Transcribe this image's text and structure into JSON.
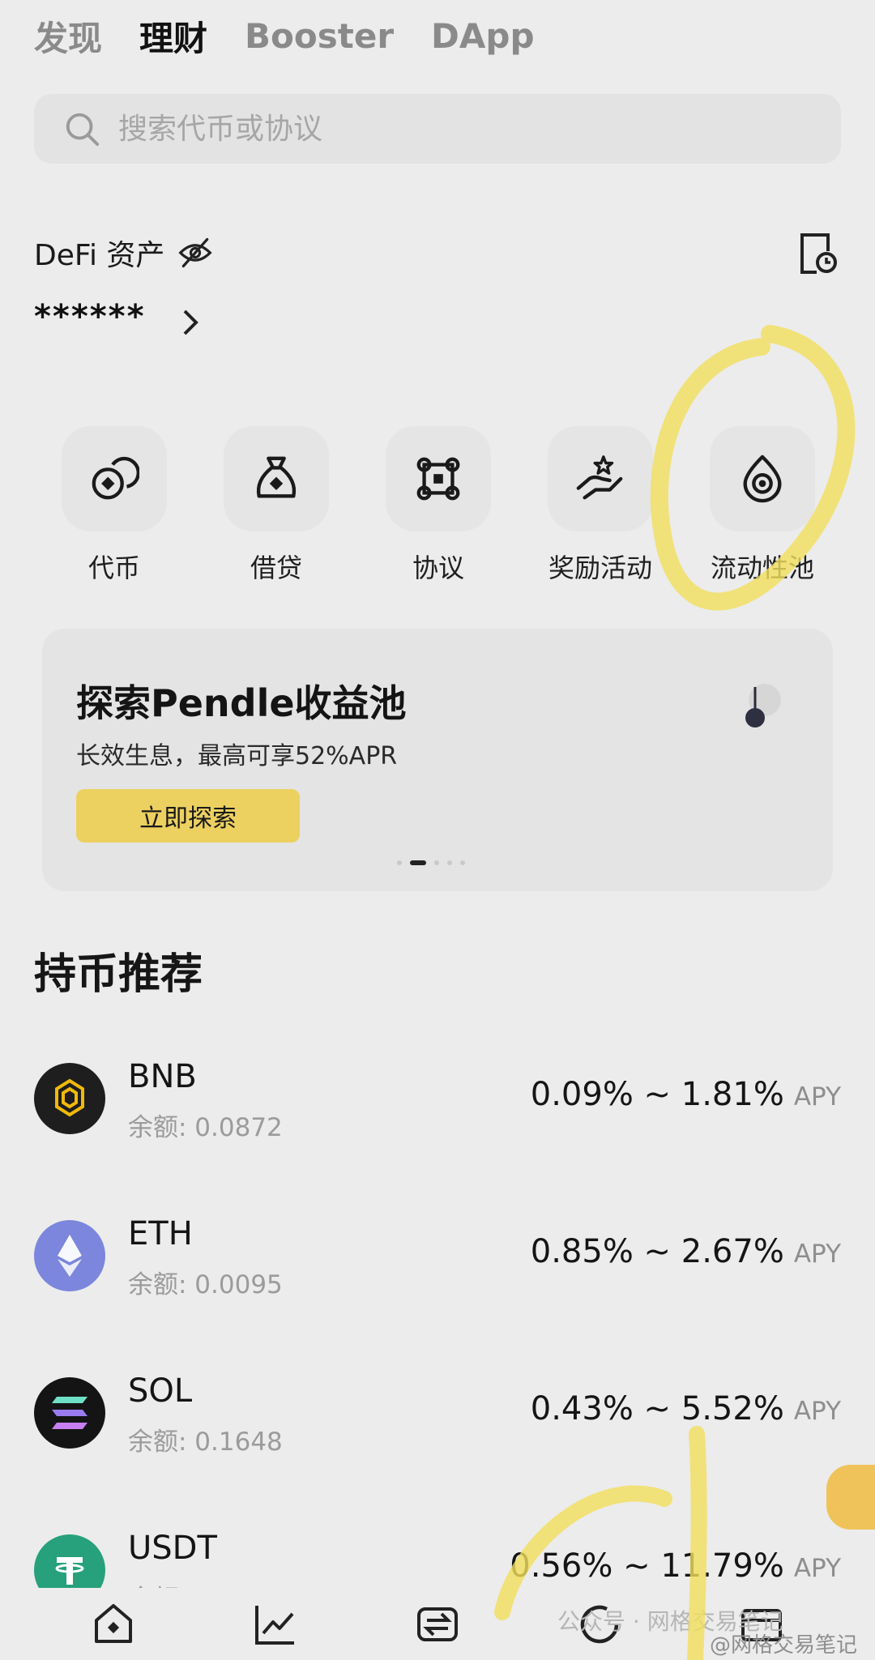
{
  "top_tabs": [
    "发现",
    "理财",
    "Booster",
    "DApp"
  ],
  "search": {
    "placeholder": "搜索代币或协议"
  },
  "defi": {
    "label": "DeFi 资产",
    "balance": "******"
  },
  "quick_menu": [
    "代币",
    "借贷",
    "协议",
    "奖励活动",
    "流动性池"
  ],
  "banner": {
    "title": "探索Pendle收益池",
    "subtitle": "长效生息，最高可享52%APR",
    "button": "立即探索"
  },
  "section": {
    "title": "持币推荐"
  },
  "coins": [
    {
      "name": "BNB",
      "balance": "余额: 0.0872",
      "apy": "0.09% ~ 1.81%",
      "tag": "APY"
    },
    {
      "name": "ETH",
      "balance": "余额: 0.0095",
      "apy": "0.85% ~ 2.67%",
      "tag": "APY"
    },
    {
      "name": "SOL",
      "balance": "余额: 0.1648",
      "apy": "0.43% ~ 5.52%",
      "tag": "APY"
    },
    {
      "name": "USDT",
      "balance": "余额: ",
      "apy": "0.56% ~ 11.79%",
      "tag": "APY"
    }
  ],
  "watermark": {
    "line1": "公众号 · 网格交易笔记",
    "line2": "@网格交易笔记"
  },
  "colors": {
    "accent": "#ecd161",
    "bnb": "#f0b90b",
    "eth": "#7b86dc",
    "usdt": "#26a17b",
    "highlight": "#f3de5c"
  },
  "icons": {
    "quick_menu": [
      "coins-icon",
      "loan-bag-icon",
      "protocol-icon",
      "reward-hand-icon",
      "liquidity-drop-icon"
    ],
    "nav": [
      "home-icon",
      "chart-icon",
      "swap-icon",
      "earn-icon",
      "wallet-icon"
    ]
  }
}
